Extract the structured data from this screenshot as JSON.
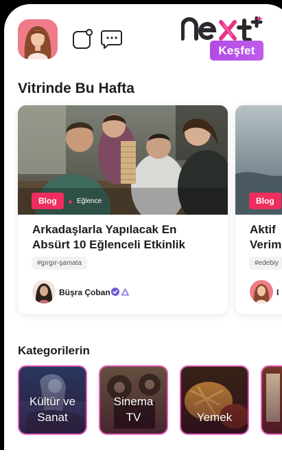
{
  "header": {
    "brand_name": "next",
    "kesfet_label": "Keşfet"
  },
  "featured": {
    "section_title": "Vitrinde Bu Hafta",
    "cards": [
      {
        "badge": "Blog",
        "category": "Eğlence",
        "title": "Arkadaşlarla Yapılacak En Absürt 10 Eğlenceli Etkinlik",
        "tag": "#gırgır-şamata",
        "author": "Büşra Çoban"
      },
      {
        "badge": "Blog",
        "title_line1": "Aktif",
        "title_line2": "Verim",
        "tag": "#edebiy",
        "author": "I"
      }
    ]
  },
  "categories": {
    "section_title": "Kategorilerin",
    "items": [
      {
        "line1": "Kültür ve",
        "line2": "Sanat"
      },
      {
        "line1": "Sinema",
        "line2": "TV"
      },
      {
        "line1": "",
        "line2": "Yemek"
      },
      {
        "line1": "",
        "line2": ""
      }
    ]
  },
  "colors": {
    "accent_purple": "#b14be6",
    "badge_red": "#ef2d5e",
    "tile_border": "#e25ab8",
    "brand_dark": "#2a2a2e",
    "brand_pink": "#e5338a"
  },
  "icons": [
    "profile-avatar",
    "notification-square-icon",
    "chat-bubble-icon",
    "verified-icon",
    "ambassador-icon"
  ]
}
